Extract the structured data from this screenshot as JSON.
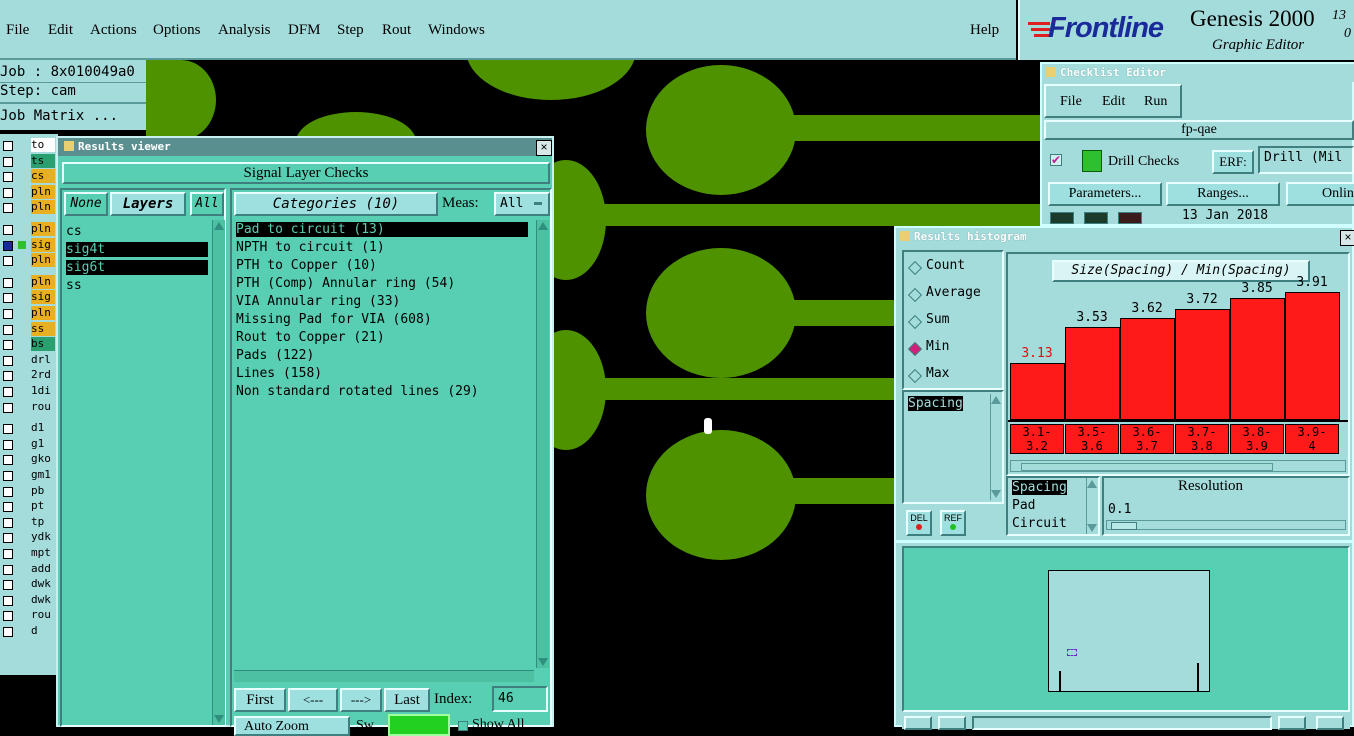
{
  "menu": [
    "File",
    "Edit",
    "Actions",
    "Options",
    "Analysis",
    "DFM",
    "Step",
    "Rout",
    "Windows"
  ],
  "help": "Help",
  "logo": {
    "brand": "Frontline",
    "product": "Genesis 2000",
    "version_top": "13",
    "version_bottom": "0",
    "subtitle": "Graphic Editor"
  },
  "job": {
    "job_line": "Job : 8x010049a0",
    "step_line": "Step: cam",
    "matrix_button": "Job Matrix ..."
  },
  "layers": [
    "to",
    "ts",
    "cs",
    "pln",
    "pln",
    "",
    "pln",
    "sig",
    "pln",
    "",
    "pln",
    "sig",
    "pln",
    "ss",
    "bs",
    "drl",
    "2rd",
    "1di",
    "rou",
    "",
    "d1",
    "g1",
    "gko",
    "gm1",
    "pb",
    "pt",
    "tp",
    "ydk",
    "mpt",
    "add",
    "dwk",
    "dwk",
    "rou",
    "d"
  ],
  "results_viewer": {
    "title": "Results viewer",
    "header": "Signal Layer Checks",
    "none_btn": "None",
    "layers_btn": "Layers",
    "all_btn": "All",
    "categories_btn": "Categories (10)",
    "meas_label": "Meas:",
    "meas_value": "All",
    "layer_items": [
      "cs",
      "sig4t",
      "sig6t",
      "ss"
    ],
    "categories": [
      "Pad to circuit (13)",
      "NPTH to circuit (1)",
      "PTH to Copper (10)",
      "PTH (Comp) Annular ring (54)",
      "VIA Annular ring (33)",
      "Missing Pad for VIA (608)",
      "Rout to Copper (21)",
      "Pads (122)",
      "Lines (158)",
      "Non standard rotated lines (29)"
    ],
    "first_btn": "First",
    "prev_btn": "<---",
    "next_btn": "--->",
    "last_btn": "Last",
    "index_label": "Index:",
    "index_value": "46",
    "auto_zoom": "Auto Zoom",
    "sw_label": "Sw",
    "show_all": "Show All"
  },
  "checklist": {
    "title": "Checklist Editor",
    "menu": [
      "File",
      "Edit",
      "Run"
    ],
    "name": "fp-qae",
    "drill_checks": "Drill Checks",
    "erf_label": "ERF:",
    "erf_value": "Drill (Mil",
    "parameters_btn": "Parameters...",
    "ranges_btn": "Ranges...",
    "online_btn": "Online",
    "date": "13 Jan 2018"
  },
  "histogram": {
    "title": "Results histogram",
    "options": [
      {
        "label": "Count",
        "selected": false
      },
      {
        "label": "Average",
        "selected": false
      },
      {
        "label": "Sum",
        "selected": false
      },
      {
        "label": "Min",
        "selected": true
      },
      {
        "label": "Max",
        "selected": false
      }
    ],
    "measure_list": [
      "Spacing"
    ],
    "chart_title": "Size(Spacing) / Min(Spacing)",
    "del_btn": "DEL",
    "ref_btn": "REF",
    "type_list": [
      "Spacing",
      "Pad",
      "Circuit"
    ],
    "resolution_label": "Resolution",
    "resolution_value": "0.1",
    "bar_color": "#ff1a1a"
  },
  "chart_data": {
    "type": "bar",
    "title": "Size(Spacing) / Min(Spacing)",
    "categories": [
      "3.1-3.2",
      "3.5-3.6",
      "3.6-3.7",
      "3.7-3.8",
      "3.8-3.9",
      "3.9-4"
    ],
    "category_lines": [
      [
        "3.1-",
        "3.2"
      ],
      [
        "3.5-",
        "3.6"
      ],
      [
        "3.6-",
        "3.7"
      ],
      [
        "3.7-",
        "3.8"
      ],
      [
        "3.8-",
        "3.9"
      ],
      [
        "3.9-",
        "4"
      ]
    ],
    "values": [
      3.13,
      3.53,
      3.62,
      3.72,
      3.85,
      3.91
    ],
    "labels": [
      "3.13",
      "3.53",
      "3.62",
      "3.72",
      "3.85",
      "3.91"
    ],
    "ylim": [
      0,
      4
    ]
  }
}
